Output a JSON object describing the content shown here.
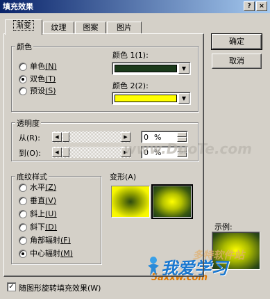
{
  "window": {
    "title": "填充效果",
    "help_glyph": "?",
    "close_glyph": "×"
  },
  "tabs": [
    {
      "label": "渐变",
      "active": true
    },
    {
      "label": "纹理",
      "active": false
    },
    {
      "label": "图案",
      "active": false
    },
    {
      "label": "图片",
      "active": false
    }
  ],
  "colors_group": {
    "title": "颜色",
    "options": [
      {
        "label": "单色",
        "key": "(N)",
        "checked": false
      },
      {
        "label": "双色",
        "key": "(T)",
        "checked": true
      },
      {
        "label": "预设",
        "key": "(S)",
        "checked": false
      }
    ],
    "color1_label": "颜色 1(1):",
    "color1_value": "#1b3a1b",
    "color2_label": "颜色 2(2):",
    "color2_value": "#ffff00"
  },
  "transparency_group": {
    "title": "透明度",
    "from_label": "从(R):",
    "from_value": "0",
    "to_label": "到(O):",
    "to_value": "0",
    "unit": "%"
  },
  "shading_group": {
    "title": "底纹样式",
    "options": [
      {
        "label": "水平",
        "key": "(Z)",
        "checked": false
      },
      {
        "label": "垂直",
        "key": "(V)",
        "checked": false
      },
      {
        "label": "斜上",
        "key": "(U)",
        "checked": false
      },
      {
        "label": "斜下",
        "key": "(D)",
        "checked": false
      },
      {
        "label": "角部辐射",
        "key": "(F)",
        "checked": false
      },
      {
        "label": "中心辐射",
        "key": "(M)",
        "checked": true
      }
    ]
  },
  "variants": {
    "label": "变形(A)"
  },
  "buttons": {
    "ok": "确定",
    "cancel": "取消"
  },
  "sample": {
    "label": "示例:"
  },
  "rotate_checkbox": {
    "label": "随图形旋转填充效果(W)",
    "checked": true,
    "check_glyph": "✓"
  },
  "glyphs": {
    "down": "▼",
    "left": "◀",
    "right": "▶"
  },
  "watermarks": {
    "site_url": "www.DuoTe.com",
    "brand": "多特软件站",
    "logo_text": "我爱学习",
    "logo_url": "5axxw.com"
  }
}
